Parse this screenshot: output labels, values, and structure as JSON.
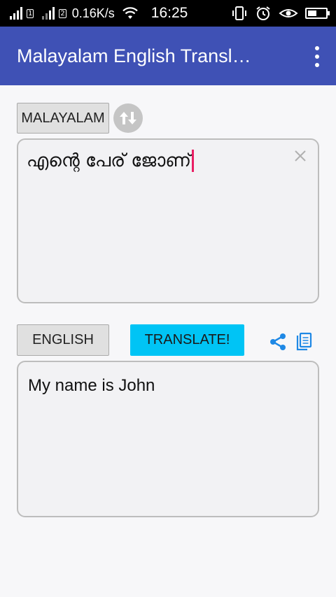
{
  "status_bar": {
    "sim1_label": "1",
    "sim2_label": "2",
    "network_speed": "0.16K/s",
    "time": "16:25",
    "icons": [
      "signal-icon",
      "wifi-icon",
      "vibrate-icon",
      "alarm-icon",
      "eye-icon",
      "battery-icon"
    ]
  },
  "app_bar": {
    "title": "Malayalam English Transl…",
    "menu_icon": "overflow-menu-icon"
  },
  "source": {
    "language_label": "MALAYALAM",
    "swap_icon": "swap-vertical-icon",
    "input_text": "എന്റെ പേര് ജോണ്",
    "clear_icon": "close-icon"
  },
  "target": {
    "language_label": "ENGLISH",
    "translate_label": "TRANSLATE!",
    "share_icon": "share-icon",
    "copy_icon": "copy-icon",
    "output_text": "My name is John"
  },
  "colors": {
    "app_bar": "#3f51b5",
    "translate_button": "#00c4f5",
    "caret": "#e91e63",
    "action_icons": "#1e88e5"
  }
}
